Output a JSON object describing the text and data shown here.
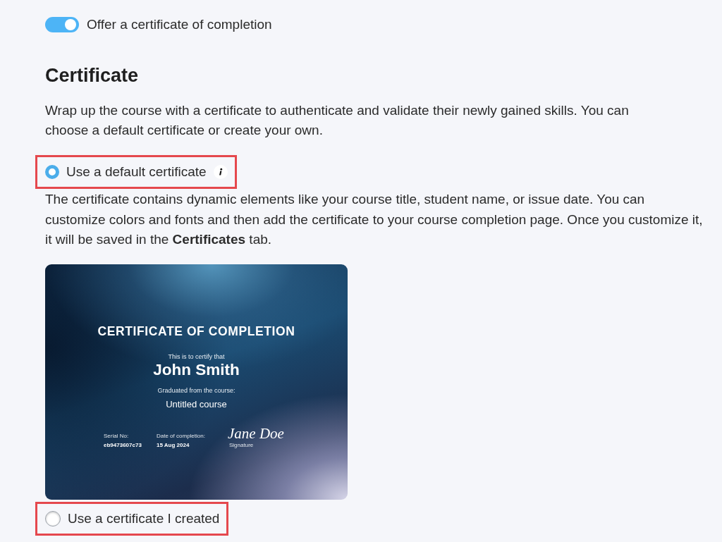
{
  "toggle": {
    "label": "Offer a certificate of completion",
    "on": true
  },
  "section": {
    "title": "Certificate",
    "description": "Wrap up the course with a certificate to authenticate and validate their newly gained skills. You can choose a default certificate or create your own."
  },
  "options": [
    {
      "label": "Use a default certificate",
      "selected": true,
      "highlighted": true,
      "info": true,
      "description": "The certificate contains dynamic elements like your course title, student name, or issue date. You can customize colors and fonts and then add the certificate to your course completion page. Once you customize it, it will be saved in the **Certificates** tab.",
      "certificate": {
        "title": "CERTIFICATE OF COMPLETION",
        "intro": "This is to certify that",
        "recipient": "John Smith",
        "course_label": "Graduated from the course:",
        "course": "Untitled course",
        "fields": [
          {
            "label": "Serial No:",
            "value": "eb9473607c73"
          },
          {
            "label": "Date of completion:",
            "value": "15 Aug 2024"
          }
        ],
        "signature": "Jane Doe",
        "signature_label": "Signature"
      }
    },
    {
      "label": "Use a certificate I created",
      "selected": false,
      "highlighted": true,
      "info": false
    }
  ]
}
